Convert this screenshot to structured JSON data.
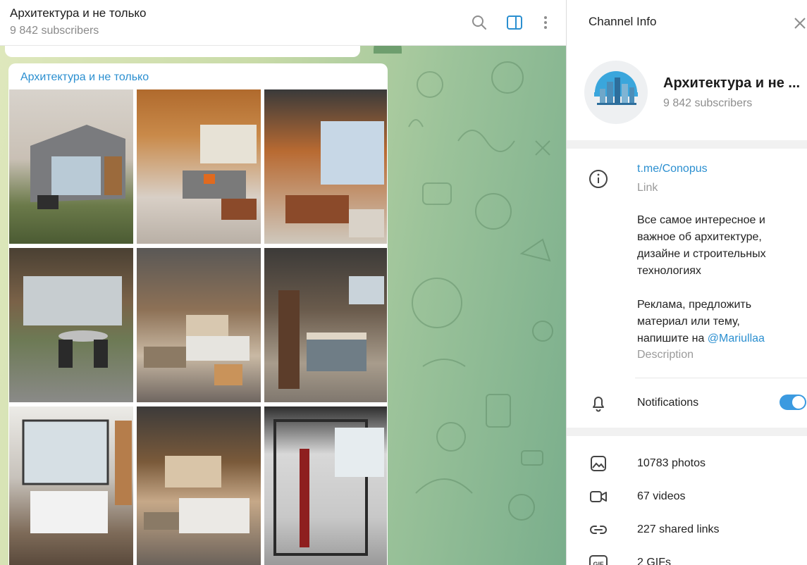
{
  "chat": {
    "title": "Архитектура и не только",
    "subscribers": "9 842 subscribers",
    "post_author": "Архитектура и не только"
  },
  "info": {
    "header_title": "Channel Info",
    "channel_name": "Архитектура и не ...",
    "subscribers": "9 842 subscribers",
    "link": "t.me/Conopus",
    "link_caption": "Link",
    "description_lines": [
      "Все самое интересное и",
      "важное об архитектуре,",
      "дизайне и строительных",
      "технологиях"
    ],
    "description_lines2": [
      "Реклама, предложить",
      "материал или тему,"
    ],
    "description_line_mention_prefix": "напишите на ",
    "mention": "@Mariullaa",
    "description_caption": "Description",
    "notifications_label": "Notifications",
    "notifications_on": true,
    "stats": {
      "photos": "10783 photos",
      "videos": "67 videos",
      "links": "227 shared links",
      "gifs": "2 GIFs"
    }
  },
  "colors": {
    "accent": "#2b8fd0",
    "toggle": "#3b9ae0"
  }
}
